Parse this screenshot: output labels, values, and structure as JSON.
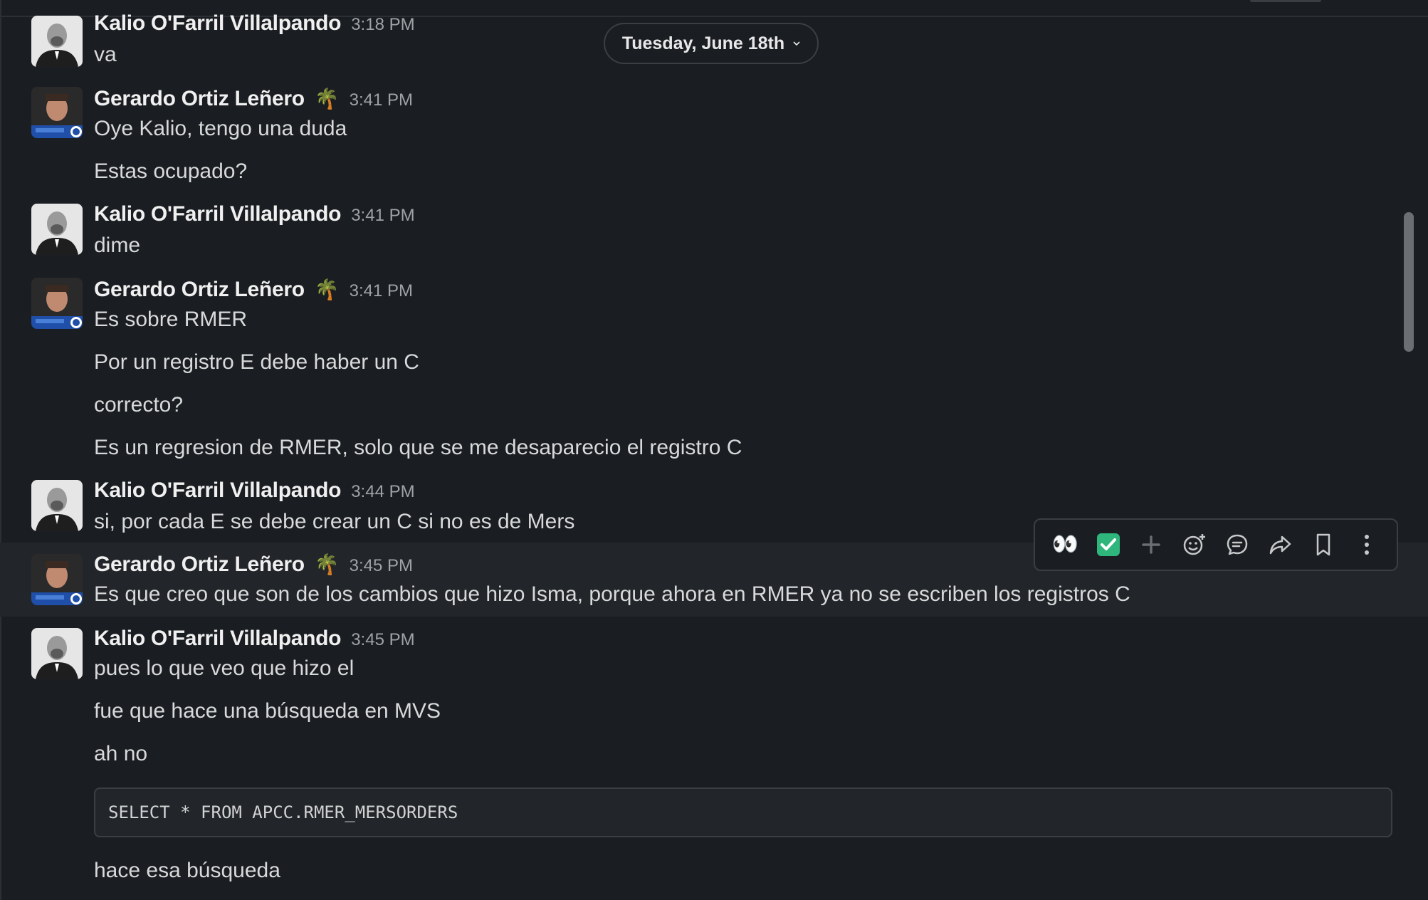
{
  "date_divider": {
    "label": "Tuesday, June 18th"
  },
  "messages": [
    {
      "author": "Kalio O'Farril Villalpando",
      "time": "3:18 PM",
      "status_emoji": "",
      "lines": [
        "va"
      ]
    },
    {
      "author": "Gerardo Ortiz Leñero",
      "time": "3:41 PM",
      "status_emoji": "🌴",
      "lines": [
        "Oye Kalio, tengo una duda",
        "Estas ocupado?"
      ]
    },
    {
      "author": "Kalio O'Farril Villalpando",
      "time": "3:41 PM",
      "status_emoji": "",
      "lines": [
        "dime"
      ]
    },
    {
      "author": "Gerardo Ortiz Leñero",
      "time": "3:41 PM",
      "status_emoji": "🌴",
      "lines": [
        "Es sobre RMER",
        "Por un registro E debe haber un C",
        "correcto?",
        "Es un regresion de RMER, solo que se me desaparecio el registro C"
      ]
    },
    {
      "author": "Kalio O'Farril Villalpando",
      "time": "3:44 PM",
      "status_emoji": "",
      "lines": [
        "si, por cada E se debe crear un C si no es de Mers"
      ]
    },
    {
      "author": "Gerardo Ortiz Leñero",
      "time": "3:45 PM",
      "status_emoji": "🌴",
      "lines": [
        "Es que creo que son de los cambios que hizo Isma, porque ahora en RMER ya no se escriben los registros C"
      ]
    },
    {
      "author": "Kalio O'Farril Villalpando",
      "time": "3:45 PM",
      "status_emoji": "",
      "lines": [
        "pues lo que veo que hizo el",
        "fue que hace una búsqueda en MVS",
        "ah no"
      ],
      "code": "SELECT * FROM APCC.RMER_MERSORDERS",
      "after_code": [
        "hace esa búsqueda"
      ]
    }
  ],
  "toolbar": {
    "reaction_eyes": "👀",
    "reaction_check": "✅",
    "icons": [
      "add-reaction-icon",
      "emoji-picker-icon",
      "reply-thread-icon",
      "forward-icon",
      "bookmark-icon",
      "more-actions-icon"
    ]
  },
  "colors": {
    "background": "#1a1d21",
    "hover_row": "#222529",
    "border": "#3b3e43",
    "check_green": "#2eb67d"
  }
}
